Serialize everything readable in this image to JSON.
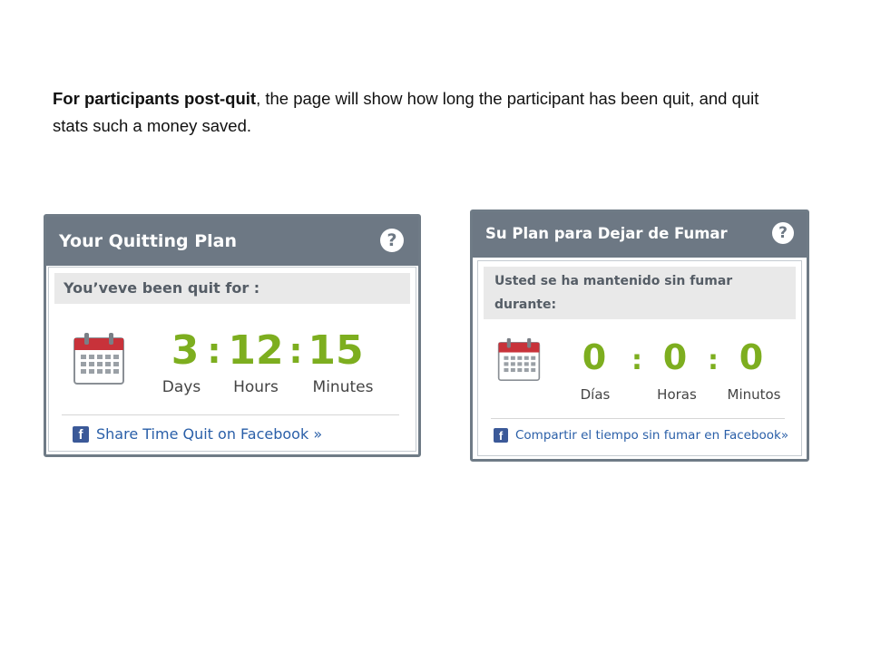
{
  "intro": {
    "bold": "For participants post-quit",
    "rest": ", the page will show how long the participant has been quit, and quit stats such a money saved."
  },
  "colors": {
    "header_bg": "#6d7884",
    "counter_green": "#7dae1f",
    "link_blue": "#2a5fa8",
    "subheader_bg": "#e9e9e9"
  },
  "widget_en": {
    "title": "Your Quitting Plan",
    "help_icon": "?",
    "subheader": "You’veve been quit for :",
    "days_value": "3",
    "hours_value": "12",
    "minutes_value": "15",
    "separator": ":",
    "days_label": "Days",
    "hours_label": "Hours",
    "minutes_label": "Minutes",
    "share_label": "Share Time Quit on Facebook »",
    "fb_icon": "f"
  },
  "widget_es": {
    "title": "Su Plan para Dejar de Fumar",
    "help_icon": "?",
    "subheader": "Usted se ha mantenido sin fumar durante:",
    "days_value": "0",
    "hours_value": "0",
    "minutes_value": "0",
    "separator": ":",
    "days_label": "Días",
    "hours_label": "Horas",
    "minutes_label": "Minutos",
    "share_label": "Compartir el tiempo sin fumar en Facebook»",
    "fb_icon": "f"
  }
}
